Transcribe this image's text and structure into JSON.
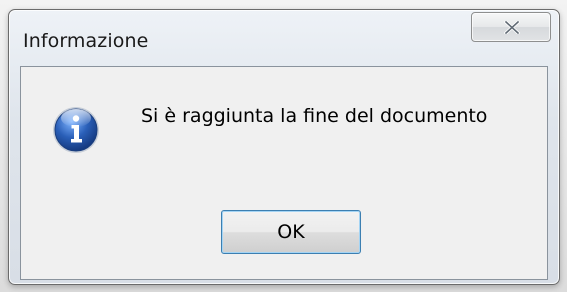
{
  "dialog": {
    "title": "Informazione",
    "message": "Si è raggiunta la fine del documento",
    "ok_label": "OK",
    "close_icon": "close-icon",
    "info_icon": "info-icon"
  },
  "colors": {
    "ok_border": "#3c7fb1",
    "info_blue": "#2a5fb8"
  }
}
